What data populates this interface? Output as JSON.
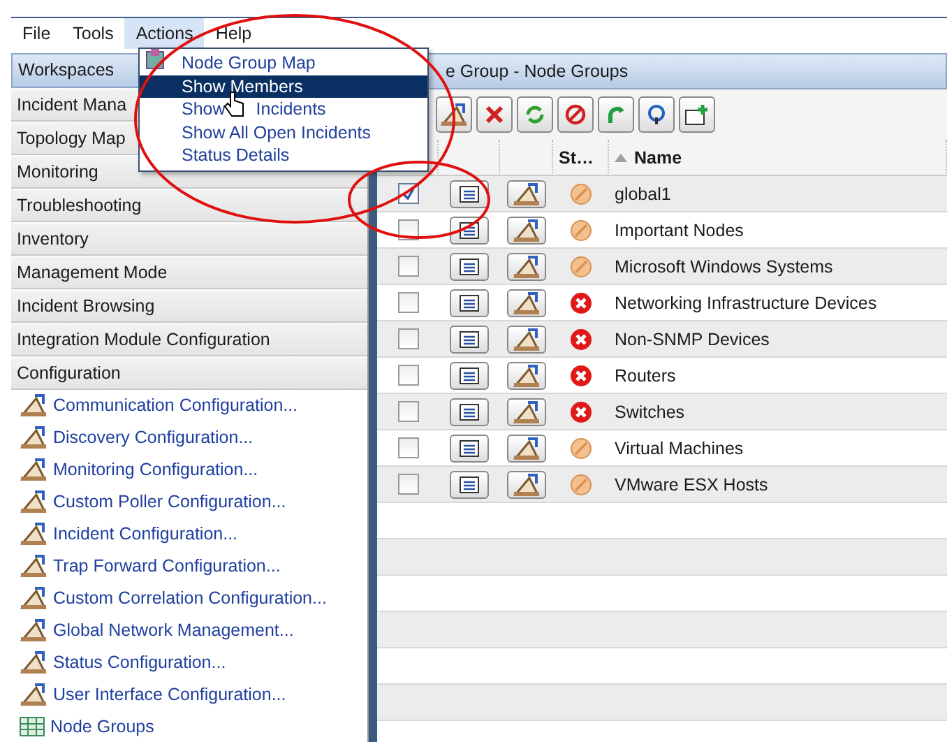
{
  "menubar": [
    {
      "label": "File",
      "selected": false
    },
    {
      "label": "Tools",
      "selected": false
    },
    {
      "label": "Actions",
      "selected": true
    },
    {
      "label": "Help",
      "selected": false
    }
  ],
  "menu": [
    {
      "parts": [
        "Node Group Map"
      ],
      "has_icon": true,
      "selected": false
    },
    {
      "parts": [
        "Show Members"
      ],
      "has_icon": false,
      "selected": true
    },
    {
      "parts": [
        "Show",
        "Incidents"
      ],
      "has_icon": false,
      "selected": false
    },
    {
      "parts": [
        "Show All Open Incidents"
      ],
      "has_icon": false,
      "selected": false
    },
    {
      "parts": [
        "Status Details"
      ],
      "has_icon": false,
      "selected": false
    }
  ],
  "sidebar": {
    "header": "Workspaces",
    "sections": [
      {
        "label": "Incident Mana"
      },
      {
        "label": "Topology Map"
      },
      {
        "label": "Monitoring"
      },
      {
        "label": "Troubleshooting"
      },
      {
        "label": "Inventory"
      },
      {
        "label": "Management Mode"
      },
      {
        "label": "Incident Browsing"
      },
      {
        "label": "Integration Module Configuration"
      },
      {
        "label": "Configuration",
        "children": [
          {
            "label": "Communication Configuration...",
            "kind": "config"
          },
          {
            "label": "Discovery Configuration...",
            "kind": "config"
          },
          {
            "label": "Monitoring Configuration...",
            "kind": "config"
          },
          {
            "label": "Custom Poller Configuration...",
            "kind": "config"
          },
          {
            "label": "Incident Configuration...",
            "kind": "config"
          },
          {
            "label": "Trap Forward Configuration...",
            "kind": "config"
          },
          {
            "label": "Custom Correlation Configuration...",
            "kind": "config"
          },
          {
            "label": "Global Network Management...",
            "kind": "config"
          },
          {
            "label": "Status Configuration...",
            "kind": "config"
          },
          {
            "label": "User Interface Configuration...",
            "kind": "config"
          },
          {
            "label": "Node Groups",
            "kind": "table"
          }
        ]
      }
    ]
  },
  "view": {
    "title": "e Group - Node Groups",
    "columns": [
      {
        "label": "St…"
      },
      {
        "label": "Name",
        "sorted": true
      }
    ],
    "rows": [
      {
        "checked": true,
        "kind": "unknown",
        "name": "global1"
      },
      {
        "checked": false,
        "kind": "unknown",
        "name": "Important Nodes"
      },
      {
        "checked": false,
        "kind": "unknown",
        "name": "Microsoft Windows Systems"
      },
      {
        "checked": false,
        "kind": "critical",
        "name": "Networking Infrastructure Devices"
      },
      {
        "checked": false,
        "kind": "critical",
        "name": "Non-SNMP Devices"
      },
      {
        "checked": false,
        "kind": "critical",
        "name": "Routers"
      },
      {
        "checked": false,
        "kind": "critical",
        "name": "Switches"
      },
      {
        "checked": false,
        "kind": "unknown",
        "name": "Virtual Machines"
      },
      {
        "checked": false,
        "kind": "unknown",
        "name": "VMware ESX Hosts"
      }
    ]
  }
}
